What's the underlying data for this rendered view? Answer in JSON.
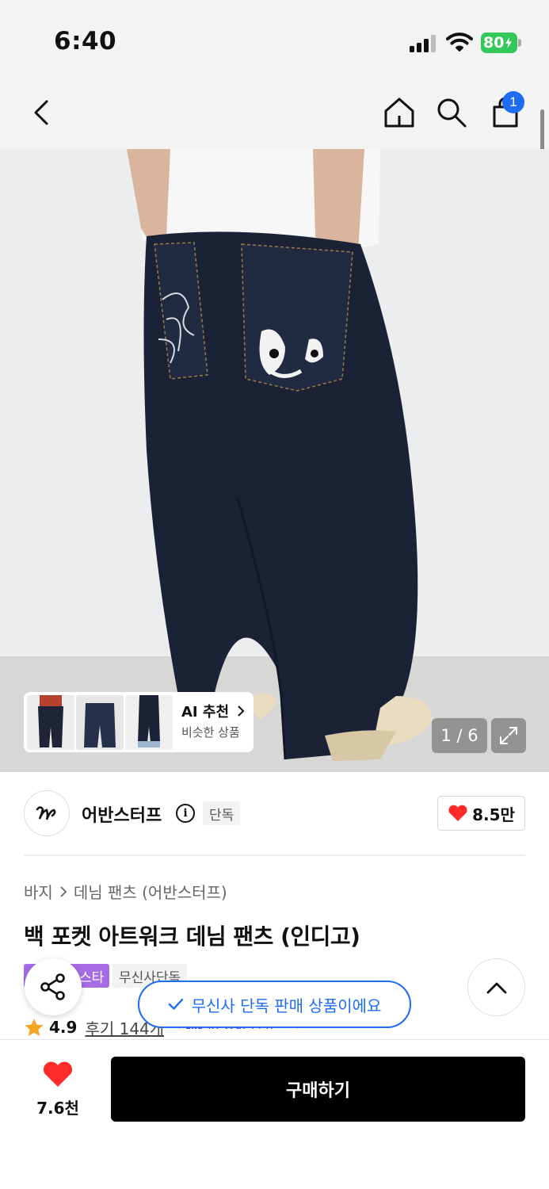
{
  "status_bar": {
    "time": "6:40",
    "battery": "80"
  },
  "nav": {
    "cart_count": "1",
    "icons": [
      "back-icon",
      "home-icon",
      "search-icon",
      "shopping-bag-icon"
    ]
  },
  "hero": {
    "ai_recommend": {
      "title": "AI 추천",
      "subtitle": "비슷한 상품"
    },
    "counter": "1 / 6"
  },
  "brand": {
    "name": "어반스터프",
    "tag": "단독",
    "likes": "8.5만"
  },
  "breadcrumb": {
    "category": "바지",
    "subcategory": "데님 팬츠 (어반스터프)"
  },
  "product": {
    "title": "백 포켓 아트워크 데님 팬츠 (인디고)"
  },
  "tags": {
    "purple": "스타",
    "gray": "무신사단독"
  },
  "toast": {
    "text": "무신사 단독 판매 상품이에요"
  },
  "rating": {
    "value": "4.9",
    "reviews": "후기 144개",
    "ai_summary": "AI 요약 보기"
  },
  "bottom": {
    "likes": "7.6천",
    "buy_label": "구매하기"
  },
  "colors": {
    "accent_blue": "#1e6cf2",
    "heart_red": "#ff2a2a",
    "tag_purple": "#a56ce6",
    "battery_green": "#34c759"
  }
}
